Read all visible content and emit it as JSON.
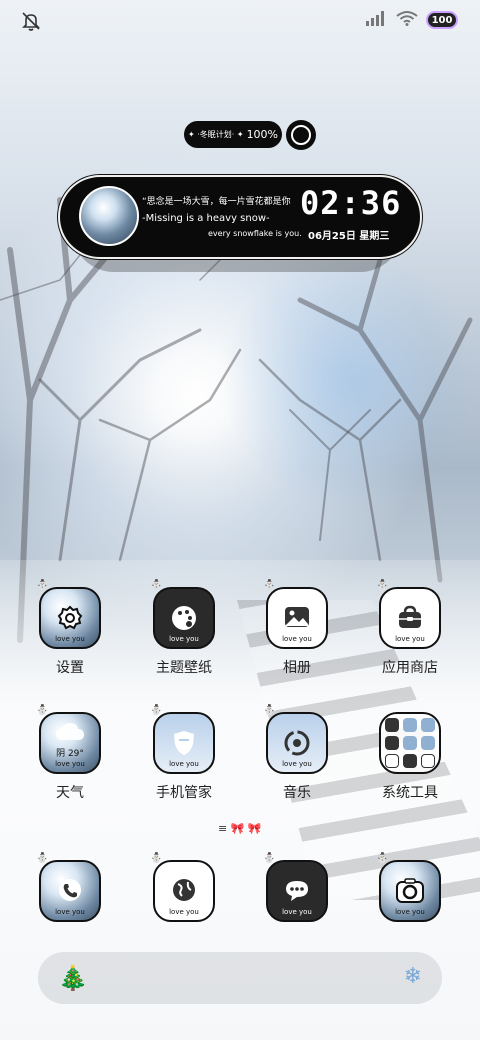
{
  "status_bar": {
    "left_icon": "bell-off-icon",
    "right_icons": [
      "signal-icon",
      "wifi-icon"
    ],
    "battery_value": "100"
  },
  "plan_pill": {
    "prefix": "✦ ·冬眠计划· ✦",
    "percent": "100%"
  },
  "widget": {
    "quote": "“思念是一场大雪，每一片雪花都是你",
    "line_en": "-Missing is a heavy snow-",
    "line_en2": "every snowflake is you.",
    "time": "02:36",
    "date": "06月25日 星期三"
  },
  "apps_row1": [
    {
      "label": "设置",
      "tile_text": "love you",
      "icon": "gear-icon"
    },
    {
      "label": "主题壁纸",
      "tile_text": "love you",
      "icon": "palette-icon"
    },
    {
      "label": "相册",
      "tile_text": "love you",
      "icon": "image-icon"
    },
    {
      "label": "应用商店",
      "tile_text": "love you",
      "icon": "bag-icon"
    }
  ],
  "apps_row2": [
    {
      "label": "天气",
      "tile_text": "love you",
      "weather": "阴 29°",
      "icon": "cloud-icon"
    },
    {
      "label": "手机管家",
      "tile_text": "love you",
      "icon": "shield-icon"
    },
    {
      "label": "音乐",
      "tile_text": "love you",
      "icon": "music-disc-icon"
    },
    {
      "label": "系统工具",
      "icon": "folder-grid-icon"
    }
  ],
  "dock_apps": [
    {
      "tile_text": "love you",
      "icon": "phone-icon"
    },
    {
      "tile_text": "love you",
      "icon": "browser-globe-icon"
    },
    {
      "tile_text": "love you",
      "icon": "message-icon"
    },
    {
      "tile_text": "love you",
      "icon": "camera-icon"
    }
  ],
  "dock": {
    "left_icon": "christmas-tree-icon",
    "right_icon": "snowflake-icon"
  },
  "page_indicator": {
    "glyphs": "≡ 🎀 🎀"
  },
  "colors": {
    "widget_bg": "#0a0a0a",
    "text_dark": "#222222",
    "battery_border": "#c9a0ff"
  }
}
